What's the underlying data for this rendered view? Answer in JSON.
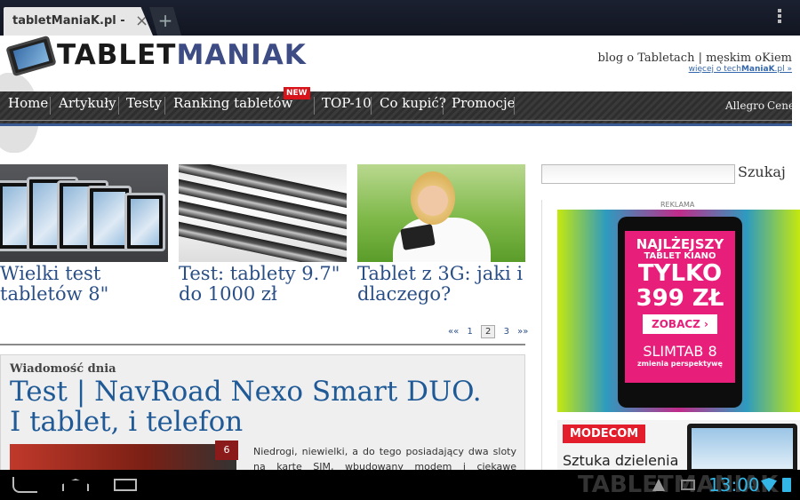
{
  "browser": {
    "tab_title": "tabletManiaK.pl - r...",
    "close_glyph": "×",
    "new_tab_glyph": "+"
  },
  "header": {
    "logo_part1": "TABLET",
    "logo_part2": "MANIAK",
    "tagline": "blog o Tabletach | męskim oKiem",
    "tech_link_prefix": "więcej o tech",
    "tech_link_bold": "ManiaK",
    "tech_link_suffix": ".pl »"
  },
  "nav": {
    "items": [
      "Home",
      "Artykuły",
      "Testy",
      "Ranking tabletów",
      "TOP-10",
      "Co kupić?",
      "Promocje"
    ],
    "new_badge": "NEW",
    "right_items": [
      "Allegro",
      "Ceneo"
    ]
  },
  "featured": [
    {
      "title": "Wielki test tabletów 8\""
    },
    {
      "title": "Test: tablety 9.7\" do 1000 zł"
    },
    {
      "title": "Tablet z 3G: jaki i dlaczego?"
    }
  ],
  "pager": {
    "first": "««",
    "p1": "1",
    "p2": "2",
    "p3": "3",
    "last": "»»",
    "current": 2
  },
  "story": {
    "label": "Wiadomość dnia",
    "title": "Test | NavRoad Nexo Smart DUO. I tablet, i telefon",
    "comments": "6",
    "excerpt": "Niedrogi, niewielki, a do tego posiadający dwa sloty na kartę SIM, wbudowany modem i ciekawe wzornictwo."
  },
  "sidebar": {
    "search_button": "Szukaj",
    "ad_label": "REKLAMA",
    "ad1": {
      "headline1": "NAJLŻEJSZY",
      "headline2": "TABLET KIANO",
      "headline3": "TYLKO",
      "price": "399 ZŁ",
      "cta": "ZOBACZ  ›",
      "brand": "SLIMTAB 8",
      "slogan": "zmienia perspektywę"
    },
    "ad2": {
      "brand": "MODECOM",
      "text": "Sztuka dzielenia"
    }
  },
  "system_bar": {
    "time": "13:00",
    "watermark": "TABLETMANIAK"
  },
  "colors": {
    "link_blue": "#2a4f86",
    "nav_bg": "#333333",
    "badge_red": "#d8141a",
    "status_blue": "#33b5e5"
  }
}
